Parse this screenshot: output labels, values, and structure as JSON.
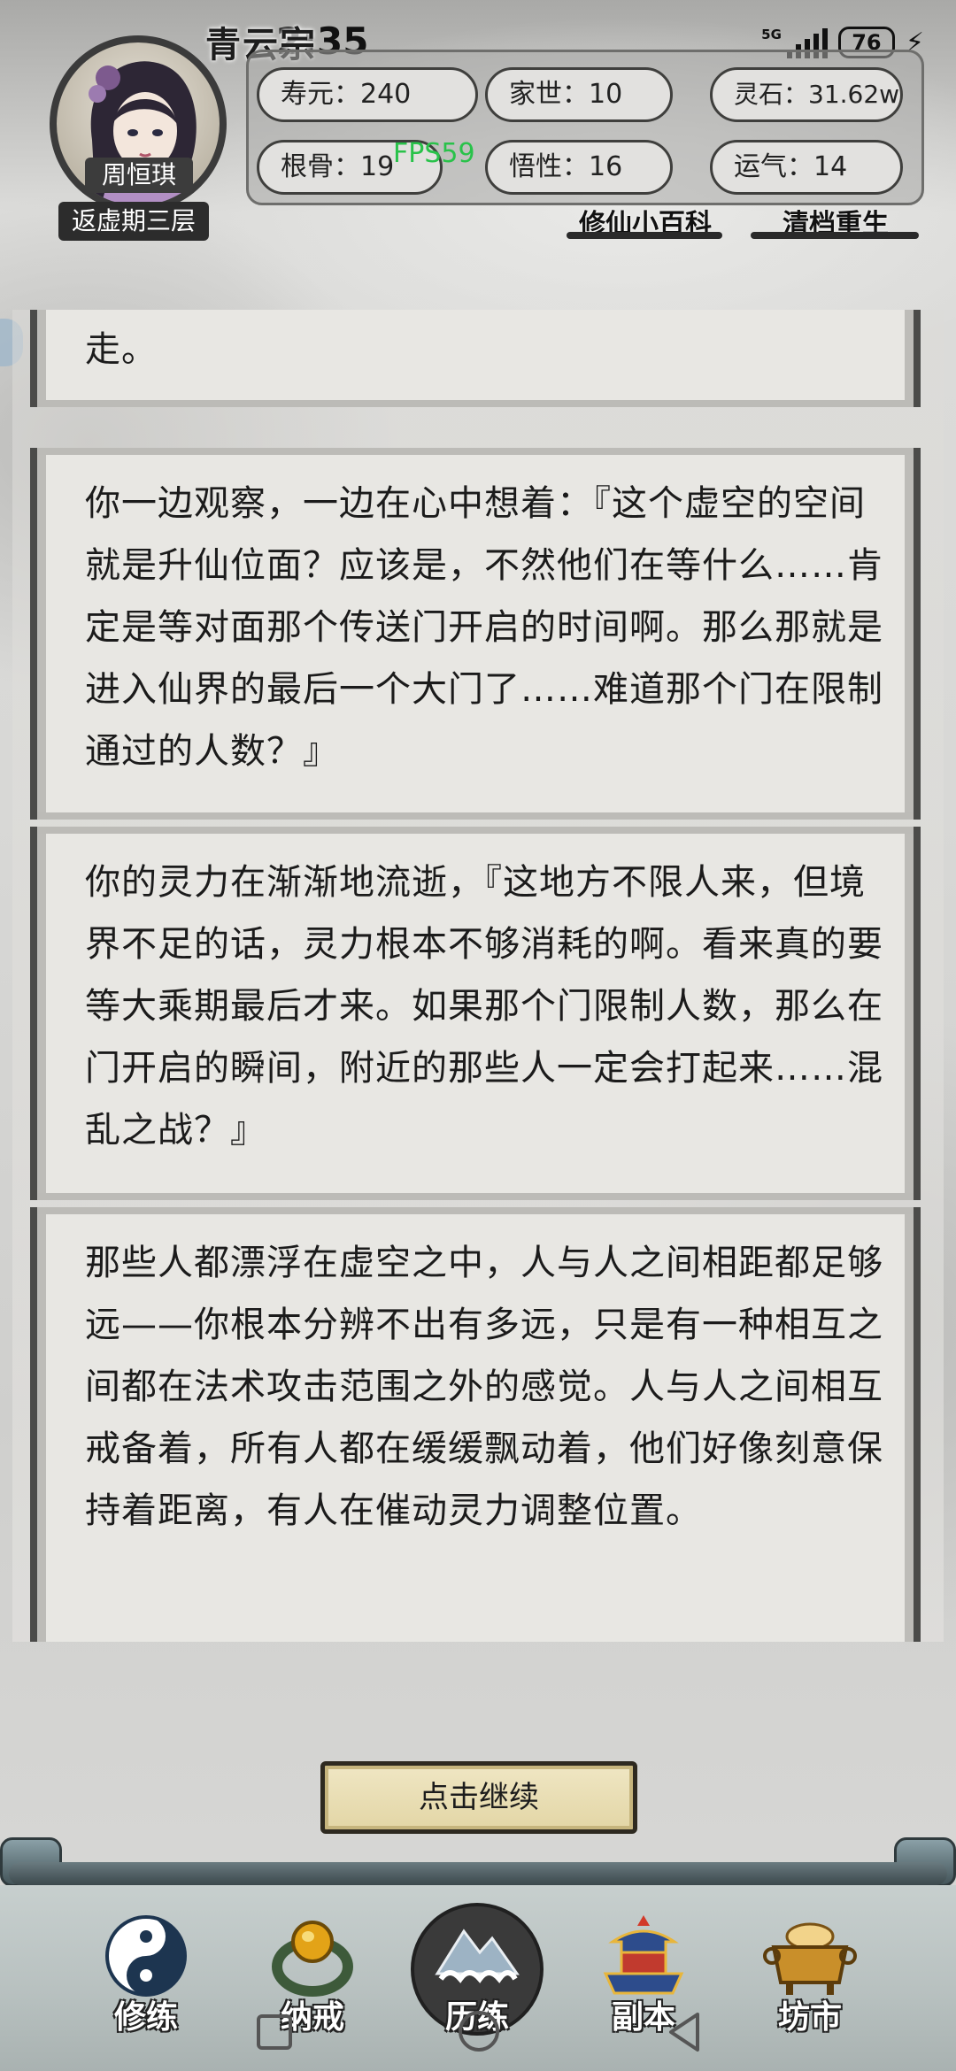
{
  "status_bar": {
    "time": "2:35",
    "network": "5G",
    "battery": "76"
  },
  "header": {
    "sect": "青云宗",
    "character_name": "周恒琪",
    "realm": "返虚期三层",
    "stats": {
      "lifespan": "寿元：240",
      "family": "家世：10",
      "spirit_stones": "灵石：31.62w",
      "root_bone": "根骨：19",
      "comprehension": "悟性：16",
      "luck": "运气：14"
    },
    "fps": "FPS59",
    "encyclopedia_link": "修仙小百科",
    "reset_link": "清档重生"
  },
  "story": {
    "partial_top": "走。",
    "paragraphs": [
      "你一边观察，一边在心中想着：『这个虚空的空间就是升仙位面？应该是，不然他们在等什么……肯定是等对面那个传送门开启的时间啊。那么那就是进入仙界的最后一个大门了……难道那个门在限制通过的人数？』",
      "你的灵力在渐渐地流逝，『这地方不限人来，但境界不足的话，灵力根本不够消耗的啊。看来真的要等大乘期最后才来。如果那个门限制人数，那么在门开启的瞬间，附近的那些人一定会打起来……混乱之战？』",
      "那些人都漂浮在虚空之中，人与人之间相距都足够远——你根本分辨不出有多远，只是有一种相互之间都在法术攻击范围之外的感觉。人与人之间相互戒备着，所有人都在缓缓飘动着，他们好像刻意保持着距离，有人在催动灵力调整位置。"
    ],
    "continue_button": "点击继续"
  },
  "nav": {
    "items": [
      {
        "label": "修练",
        "icon": "yin-yang-icon"
      },
      {
        "label": "纳戒",
        "icon": "ring-icon"
      },
      {
        "label": "历练",
        "icon": "mountain-cloud-icon"
      },
      {
        "label": "副本",
        "icon": "pagoda-icon"
      },
      {
        "label": "坊市",
        "icon": "cauldron-icon"
      }
    ]
  }
}
